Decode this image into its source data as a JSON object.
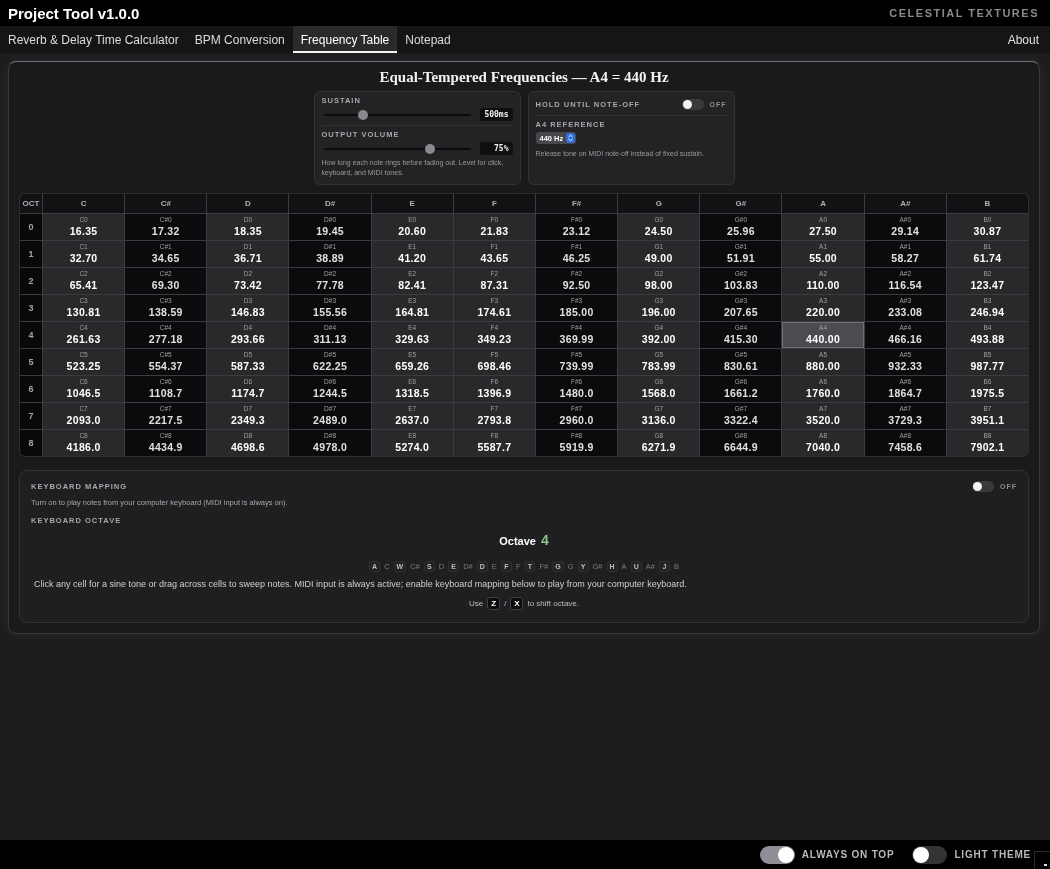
{
  "window": {
    "title": "Project Tool v1.0.0",
    "brand": "CELESTIAL TEXTURES"
  },
  "tabs": [
    {
      "label": "Reverb & Delay Time Calculator",
      "selected": false
    },
    {
      "label": "BPM Conversion",
      "selected": false
    },
    {
      "label": "Frequency Table",
      "selected": true
    },
    {
      "label": "Notepad",
      "selected": false
    }
  ],
  "about_link": "About",
  "panel": {
    "title": "Equal-Tempered Frequencies — A4 = 440 Hz"
  },
  "sliders": [
    {
      "label": "SUSTAIN",
      "level": 0.25,
      "reading": "500ms"
    },
    {
      "label": "OUTPUT VOLUME",
      "level": 0.74,
      "reading": "75%"
    }
  ],
  "sliders_help": "How long each note rings before fading out. Level for click, keyboard, and MIDI tones.",
  "hold": {
    "label": "HOLD UNTIL NOTE-OFF",
    "on": false,
    "state_label": "OFF"
  },
  "reference": {
    "label": "A4 REFERENCE",
    "value": "440 Hz",
    "help": "Release tone on MIDI note-off instead of fixed sustain."
  },
  "table": {
    "octave_header": "OCT",
    "columns": [
      {
        "label": "C",
        "kind": "natural"
      },
      {
        "label": "C#",
        "kind": "sharp"
      },
      {
        "label": "D",
        "kind": "natural"
      },
      {
        "label": "D#",
        "kind": "sharp"
      },
      {
        "label": "E",
        "kind": "natural"
      },
      {
        "label": "F",
        "kind": "natural"
      },
      {
        "label": "F#",
        "kind": "sharp"
      },
      {
        "label": "G",
        "kind": "natural"
      },
      {
        "label": "G#",
        "kind": "sharp"
      },
      {
        "label": "A",
        "kind": "natural"
      },
      {
        "label": "A#",
        "kind": "sharp"
      },
      {
        "label": "B",
        "kind": "natural"
      }
    ],
    "rows": [
      {
        "octave": "0",
        "cells": [
          {
            "note": "C0",
            "freq": "16.35",
            "selected": false
          },
          {
            "note": "C#0",
            "freq": "17.32",
            "selected": false
          },
          {
            "note": "D0",
            "freq": "18.35",
            "selected": false
          },
          {
            "note": "D#0",
            "freq": "19.45",
            "selected": false
          },
          {
            "note": "E0",
            "freq": "20.60",
            "selected": false
          },
          {
            "note": "F0",
            "freq": "21.83",
            "selected": false
          },
          {
            "note": "F#0",
            "freq": "23.12",
            "selected": false
          },
          {
            "note": "G0",
            "freq": "24.50",
            "selected": false
          },
          {
            "note": "G#0",
            "freq": "25.96",
            "selected": false
          },
          {
            "note": "A0",
            "freq": "27.50",
            "selected": false
          },
          {
            "note": "A#0",
            "freq": "29.14",
            "selected": false
          },
          {
            "note": "B0",
            "freq": "30.87",
            "selected": false
          }
        ]
      },
      {
        "octave": "1",
        "cells": [
          {
            "note": "C1",
            "freq": "32.70",
            "selected": false
          },
          {
            "note": "C#1",
            "freq": "34.65",
            "selected": false
          },
          {
            "note": "D1",
            "freq": "36.71",
            "selected": false
          },
          {
            "note": "D#1",
            "freq": "38.89",
            "selected": false
          },
          {
            "note": "E1",
            "freq": "41.20",
            "selected": false
          },
          {
            "note": "F1",
            "freq": "43.65",
            "selected": false
          },
          {
            "note": "F#1",
            "freq": "46.25",
            "selected": false
          },
          {
            "note": "G1",
            "freq": "49.00",
            "selected": false
          },
          {
            "note": "G#1",
            "freq": "51.91",
            "selected": false
          },
          {
            "note": "A1",
            "freq": "55.00",
            "selected": false
          },
          {
            "note": "A#1",
            "freq": "58.27",
            "selected": false
          },
          {
            "note": "B1",
            "freq": "61.74",
            "selected": false
          }
        ]
      },
      {
        "octave": "2",
        "cells": [
          {
            "note": "C2",
            "freq": "65.41",
            "selected": false
          },
          {
            "note": "C#2",
            "freq": "69.30",
            "selected": false
          },
          {
            "note": "D2",
            "freq": "73.42",
            "selected": false
          },
          {
            "note": "D#2",
            "freq": "77.78",
            "selected": false
          },
          {
            "note": "E2",
            "freq": "82.41",
            "selected": false
          },
          {
            "note": "F2",
            "freq": "87.31",
            "selected": false
          },
          {
            "note": "F#2",
            "freq": "92.50",
            "selected": false
          },
          {
            "note": "G2",
            "freq": "98.00",
            "selected": false
          },
          {
            "note": "G#2",
            "freq": "103.83",
            "selected": false
          },
          {
            "note": "A2",
            "freq": "110.00",
            "selected": false
          },
          {
            "note": "A#2",
            "freq": "116.54",
            "selected": false
          },
          {
            "note": "B2",
            "freq": "123.47",
            "selected": false
          }
        ]
      },
      {
        "octave": "3",
        "cells": [
          {
            "note": "C3",
            "freq": "130.81",
            "selected": false
          },
          {
            "note": "C#3",
            "freq": "138.59",
            "selected": false
          },
          {
            "note": "D3",
            "freq": "146.83",
            "selected": false
          },
          {
            "note": "D#3",
            "freq": "155.56",
            "selected": false
          },
          {
            "note": "E3",
            "freq": "164.81",
            "selected": false
          },
          {
            "note": "F3",
            "freq": "174.61",
            "selected": false
          },
          {
            "note": "F#3",
            "freq": "185.00",
            "selected": false
          },
          {
            "note": "G3",
            "freq": "196.00",
            "selected": false
          },
          {
            "note": "G#3",
            "freq": "207.65",
            "selected": false
          },
          {
            "note": "A3",
            "freq": "220.00",
            "selected": false
          },
          {
            "note": "A#3",
            "freq": "233.08",
            "selected": false
          },
          {
            "note": "B3",
            "freq": "246.94",
            "selected": false
          }
        ]
      },
      {
        "octave": "4",
        "cells": [
          {
            "note": "C4",
            "freq": "261.63",
            "selected": false
          },
          {
            "note": "C#4",
            "freq": "277.18",
            "selected": false
          },
          {
            "note": "D4",
            "freq": "293.66",
            "selected": false
          },
          {
            "note": "D#4",
            "freq": "311.13",
            "selected": false
          },
          {
            "note": "E4",
            "freq": "329.63",
            "selected": false
          },
          {
            "note": "F4",
            "freq": "349.23",
            "selected": false
          },
          {
            "note": "F#4",
            "freq": "369.99",
            "selected": false
          },
          {
            "note": "G4",
            "freq": "392.00",
            "selected": false
          },
          {
            "note": "G#4",
            "freq": "415.30",
            "selected": false
          },
          {
            "note": "A4",
            "freq": "440.00",
            "selected": true
          },
          {
            "note": "A#4",
            "freq": "466.16",
            "selected": false
          },
          {
            "note": "B4",
            "freq": "493.88",
            "selected": false
          }
        ]
      },
      {
        "octave": "5",
        "cells": [
          {
            "note": "C5",
            "freq": "523.25",
            "selected": false
          },
          {
            "note": "C#5",
            "freq": "554.37",
            "selected": false
          },
          {
            "note": "D5",
            "freq": "587.33",
            "selected": false
          },
          {
            "note": "D#5",
            "freq": "622.25",
            "selected": false
          },
          {
            "note": "E5",
            "freq": "659.26",
            "selected": false
          },
          {
            "note": "F5",
            "freq": "698.46",
            "selected": false
          },
          {
            "note": "F#5",
            "freq": "739.99",
            "selected": false
          },
          {
            "note": "G5",
            "freq": "783.99",
            "selected": false
          },
          {
            "note": "G#5",
            "freq": "830.61",
            "selected": false
          },
          {
            "note": "A5",
            "freq": "880.00",
            "selected": false
          },
          {
            "note": "A#5",
            "freq": "932.33",
            "selected": false
          },
          {
            "note": "B5",
            "freq": "987.77",
            "selected": false
          }
        ]
      },
      {
        "octave": "6",
        "cells": [
          {
            "note": "C6",
            "freq": "1046.5",
            "selected": false
          },
          {
            "note": "C#6",
            "freq": "1108.7",
            "selected": false
          },
          {
            "note": "D6",
            "freq": "1174.7",
            "selected": false
          },
          {
            "note": "D#6",
            "freq": "1244.5",
            "selected": false
          },
          {
            "note": "E6",
            "freq": "1318.5",
            "selected": false
          },
          {
            "note": "F6",
            "freq": "1396.9",
            "selected": false
          },
          {
            "note": "F#6",
            "freq": "1480.0",
            "selected": false
          },
          {
            "note": "G6",
            "freq": "1568.0",
            "selected": false
          },
          {
            "note": "G#6",
            "freq": "1661.2",
            "selected": false
          },
          {
            "note": "A6",
            "freq": "1760.0",
            "selected": false
          },
          {
            "note": "A#6",
            "freq": "1864.7",
            "selected": false
          },
          {
            "note": "B6",
            "freq": "1975.5",
            "selected": false
          }
        ]
      },
      {
        "octave": "7",
        "cells": [
          {
            "note": "C7",
            "freq": "2093.0",
            "selected": false
          },
          {
            "note": "C#7",
            "freq": "2217.5",
            "selected": false
          },
          {
            "note": "D7",
            "freq": "2349.3",
            "selected": false
          },
          {
            "note": "D#7",
            "freq": "2489.0",
            "selected": false
          },
          {
            "note": "E7",
            "freq": "2637.0",
            "selected": false
          },
          {
            "note": "F7",
            "freq": "2793.8",
            "selected": false
          },
          {
            "note": "F#7",
            "freq": "2960.0",
            "selected": false
          },
          {
            "note": "G7",
            "freq": "3136.0",
            "selected": false
          },
          {
            "note": "G#7",
            "freq": "3322.4",
            "selected": false
          },
          {
            "note": "A7",
            "freq": "3520.0",
            "selected": false
          },
          {
            "note": "A#7",
            "freq": "3729.3",
            "selected": false
          },
          {
            "note": "B7",
            "freq": "3951.1",
            "selected": false
          }
        ]
      },
      {
        "octave": "8",
        "cells": [
          {
            "note": "C8",
            "freq": "4186.0",
            "selected": false
          },
          {
            "note": "C#8",
            "freq": "4434.9",
            "selected": false
          },
          {
            "note": "D8",
            "freq": "4698.6",
            "selected": false
          },
          {
            "note": "D#8",
            "freq": "4978.0",
            "selected": false
          },
          {
            "note": "E8",
            "freq": "5274.0",
            "selected": false
          },
          {
            "note": "F8",
            "freq": "5587.7",
            "selected": false
          },
          {
            "note": "F#8",
            "freq": "5919.9",
            "selected": false
          },
          {
            "note": "G8",
            "freq": "6271.9",
            "selected": false
          },
          {
            "note": "G#8",
            "freq": "6644.9",
            "selected": false
          },
          {
            "note": "A8",
            "freq": "7040.0",
            "selected": false
          },
          {
            "note": "A#8",
            "freq": "7458.6",
            "selected": false
          },
          {
            "note": "B8",
            "freq": "7902.1",
            "selected": false
          }
        ]
      }
    ]
  },
  "keyboard": {
    "title": "KEYBOARD MAPPING",
    "on": false,
    "state_label": "OFF",
    "help": "Turn on to play notes from your computer keyboard (MIDI input is always on).",
    "octave_heading": "KEYBOARD OCTAVE",
    "octave_word": "Octave",
    "octave_value": "4",
    "keys": [
      {
        "key": "A",
        "note": "C"
      },
      {
        "key": "W",
        "note": "C#"
      },
      {
        "key": "S",
        "note": "D"
      },
      {
        "key": "E",
        "note": "D#"
      },
      {
        "key": "D",
        "note": "E"
      },
      {
        "key": "F",
        "note": "F"
      },
      {
        "key": "T",
        "note": "F#"
      },
      {
        "key": "G",
        "note": "G"
      },
      {
        "key": "Y",
        "note": "G#"
      },
      {
        "key": "H",
        "note": "A"
      },
      {
        "key": "U",
        "note": "A#"
      },
      {
        "key": "J",
        "note": "B"
      }
    ],
    "instructions": "Click any cell for a sine tone or drag across cells to sweep notes. MIDI input is always active; enable keyboard mapping below to play from your computer keyboard.",
    "shift": {
      "before": "Use",
      "keys": [
        "Z",
        "X"
      ],
      "separator": "/",
      "after": "to shift octave."
    }
  },
  "status_bar": {
    "toggles": [
      {
        "label": "ALWAYS ON TOP",
        "on": true
      },
      {
        "label": "LIGHT THEME",
        "on": false
      }
    ]
  }
}
